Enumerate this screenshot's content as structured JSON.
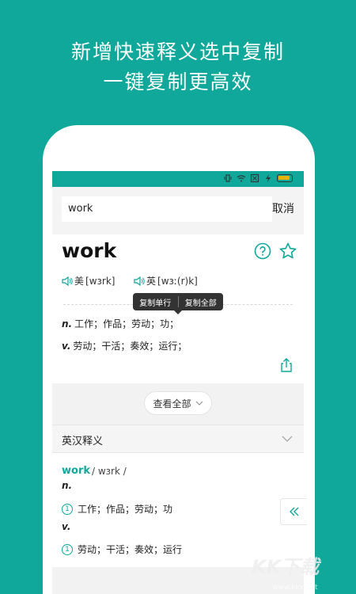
{
  "promo": {
    "line1": "新增快速释义选中复制",
    "line2": "一键复制更高效"
  },
  "colors": {
    "accent": "#0fa89a"
  },
  "search": {
    "value": "work",
    "cancel_label": "取消"
  },
  "word": {
    "headword": "work",
    "us_label": "美",
    "us_phonetic": "[wɜrk]",
    "uk_label": "英",
    "uk_phonetic": "[wɜː(r)k]"
  },
  "popup": {
    "copy_line": "复制单行",
    "copy_all": "复制全部"
  },
  "definitions": [
    {
      "pos": "n.",
      "text": "工作；作品；劳动；功；"
    },
    {
      "pos": "v.",
      "text": "劳动；干活；奏效；运行；"
    }
  ],
  "view_all_label": "查看全部",
  "section": {
    "title": "英汉释义"
  },
  "entry": {
    "word": "work",
    "phonetic": "/ wɜrk /",
    "senses": [
      {
        "pos": "n.",
        "num": "1",
        "text": "工作；作品；劳动；功"
      },
      {
        "pos": "v.",
        "num": "1",
        "text": "劳动；干活；奏效；运行"
      }
    ]
  },
  "watermark": {
    "logo": "KK下载",
    "url": "www.kkx.net"
  },
  "icons": [
    "help-icon",
    "star-icon",
    "speaker-icon",
    "share-icon",
    "chevron-down-icon",
    "collapse-icon"
  ]
}
